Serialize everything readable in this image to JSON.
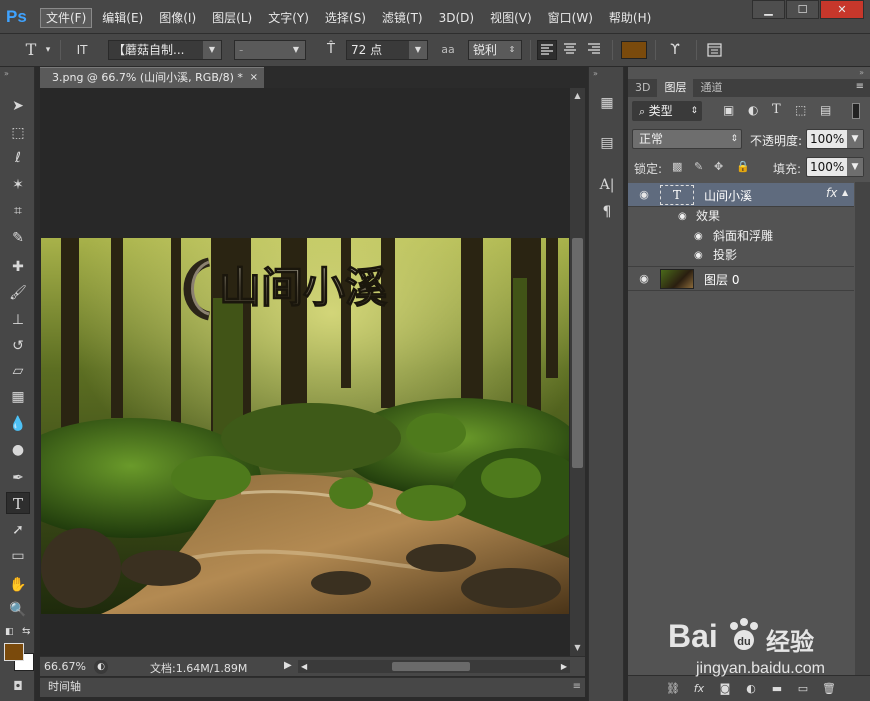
{
  "app": {
    "logo": "Ps"
  },
  "menu": [
    "文件(F)",
    "编辑(E)",
    "图像(I)",
    "图层(L)",
    "文字(Y)",
    "选择(S)",
    "滤镜(T)",
    "3D(D)",
    "视图(V)",
    "窗口(W)",
    "帮助(H)"
  ],
  "window_controls": {
    "minimize": "▁",
    "maximize": "☐",
    "close": "✕"
  },
  "options": {
    "tool_icon": "T",
    "orientation_icon": "IT",
    "font_family": "【蘑菇自制...",
    "font_style": "-",
    "font_size": "72 点",
    "aa_label": "aa",
    "antialias": "锐利",
    "color_swatch": "#7a4a0c"
  },
  "document": {
    "tab_title": "3.png @ 66.7% (山间小溪, RGB/8) *",
    "close": "×",
    "overlay_text": "山间小溪"
  },
  "status": {
    "zoom": "66.67%",
    "doc_info": "文档:1.64M/1.89M"
  },
  "timeline": {
    "label": "时间轴"
  },
  "panel": {
    "tabs": [
      "3D",
      "图层",
      "通道"
    ],
    "filter_label": "类型",
    "blend_mode": "正常",
    "opacity_label": "不透明度:",
    "opacity_value": "100%",
    "lock_label": "锁定:",
    "fill_label": "填充:",
    "fill_value": "100%",
    "layers": [
      {
        "name": "山间小溪",
        "fx": "fx",
        "effects_label": "效果",
        "effects": [
          "斜面和浮雕",
          "投影"
        ]
      },
      {
        "name": "图层 0"
      }
    ]
  },
  "watermark": {
    "brand": "Bai",
    "brand2": "经验",
    "url": "jingyan.baidu.com"
  },
  "colors": {
    "foreground": "#7a4a0c",
    "background": "#ffffff",
    "accent": "#3fa3ff"
  }
}
